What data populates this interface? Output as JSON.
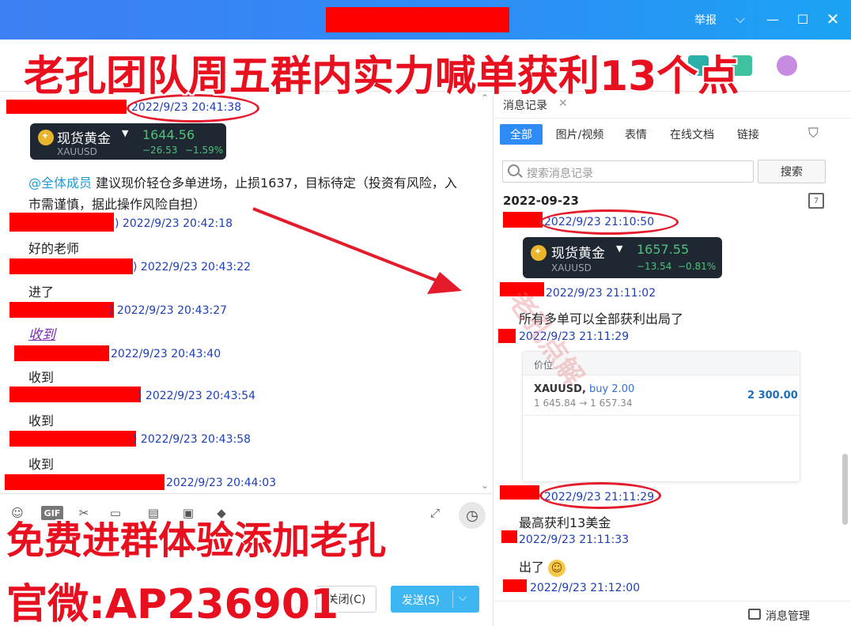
{
  "titlebar": {
    "report_label": "举报",
    "chevron_icon": "chevron-down-icon",
    "min_icon": "minimize-icon",
    "max_icon": "maximize-icon",
    "close_icon": "close-icon"
  },
  "banners": {
    "top": "老孔团队周五群内实力喊单获利13个点",
    "bottom1": "免费进群体验添加老孔",
    "bottom2": "官微:AP236901"
  },
  "left_chat": {
    "messages": [
      {
        "time": "2022/9/23 20:41:38"
      },
      {
        "card": {
          "name": "现货黄金",
          "price": "1644.56",
          "symbol": "XAUUSD",
          "change": "−26.53",
          "change_pct": "−1.59%"
        }
      },
      {
        "mention": "@全体成员",
        "text1": " 建议现价轻仓多单进场，止损1637，目标待定（投资有风险，入",
        "text2": "市需谨慎，据此操作风险自担）"
      },
      {
        "time": ") 2022/9/23 20:42:18",
        "text": "好的老师"
      },
      {
        "time": ") 2022/9/23 20:43:22",
        "text": "进了"
      },
      {
        "time": ") 2022/9/23 20:43:27",
        "text": "收到"
      },
      {
        "time": "2022/9/23 20:43:40",
        "text": "收到"
      },
      {
        "time": ") 2022/9/23 20:43:54",
        "text": "收到"
      },
      {
        "time": ") 2022/9/23 20:43:58",
        "text": "收到"
      },
      {
        "time": "2022/9/23 20:44:03"
      }
    ]
  },
  "input": {
    "close_label": "关闭(C)",
    "send_label": "发送(S)",
    "gif_label": "GIF"
  },
  "right_pane": {
    "tab_title": "消息记录",
    "filters": [
      "全部",
      "图片/视频",
      "表情",
      "在线文档",
      "链接"
    ],
    "search_placeholder": "搜索消息记录",
    "search_button": "搜索",
    "date": "2022-09-23",
    "messages": [
      {
        "time": "2022/9/23 21:10:50"
      },
      {
        "card": {
          "name": "现货黄金",
          "price": "1657.55",
          "symbol": "XAUUSD",
          "change": "−13.54",
          "change_pct": "−0.81%"
        }
      },
      {
        "time": "2022/9/23 21:11:02",
        "text": "所有多单可以全部获利出局了"
      },
      {
        "time": "2022/9/23 21:11:29"
      },
      {
        "position": {
          "header": "价位",
          "symbol": "XAUUSD,",
          "side": " buy 2.00",
          "prices": "1 645.84 → 1 657.34",
          "profit": "2 300.00"
        }
      },
      {
        "time": "2022/9/23 21:11:29",
        "text": "最高获利13美金"
      },
      {
        "time": "2022/9/23 21:11:33",
        "text": "出了"
      },
      {
        "time": "2022/9/23 21:12:00"
      }
    ],
    "watermark": "老孔点解",
    "msg_manager": "消息管理"
  },
  "colors": {
    "titlebar": "#2f8cf6",
    "banner_red": "#e8101f",
    "timestamp_blue": "#1e3fb6",
    "gain_green": "#4ec27b",
    "send_blue": "#3db6f2"
  }
}
